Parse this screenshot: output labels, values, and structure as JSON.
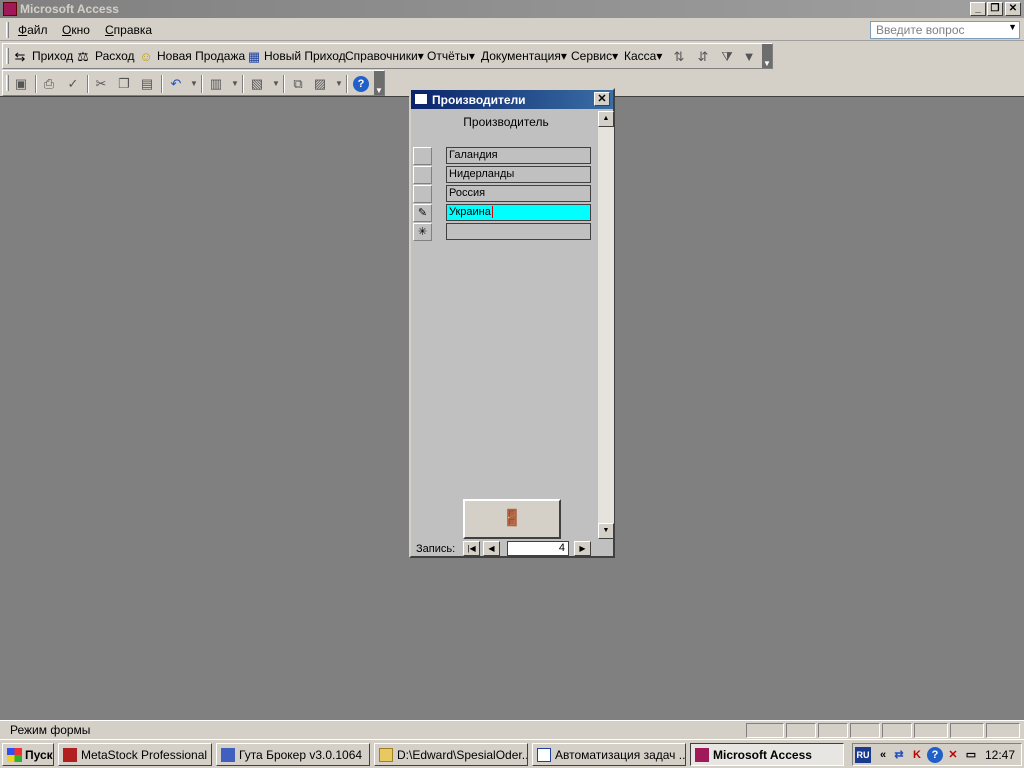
{
  "app": {
    "title": "Microsoft Access"
  },
  "menu": {
    "items": [
      {
        "label": "Файл"
      },
      {
        "label": "Окно"
      },
      {
        "label": "Справка"
      }
    ],
    "ask_placeholder": "Введите вопрос"
  },
  "toolbar_custom": {
    "items": [
      {
        "label": "Приход",
        "icon": "incoming-icon"
      },
      {
        "label": "Расход",
        "icon": "scales-icon"
      },
      {
        "label": "Новая Продажа",
        "icon": "smiley-icon"
      },
      {
        "label": "Новый Приход",
        "icon": "calculator-icon"
      },
      {
        "label": "Справочники▾"
      },
      {
        "label": "Отчёты▾"
      },
      {
        "label": "Документация▾"
      },
      {
        "label": "Сервис▾"
      },
      {
        "label": "Касса▾"
      }
    ]
  },
  "form": {
    "title": "Производители",
    "header": "Производитель",
    "records": [
      "Галандия",
      "Нидерланды",
      "Россия",
      "Украина"
    ],
    "active_index": 3,
    "new_record_marker": "✳",
    "edit_marker": "✎",
    "nav_label": "Запись:",
    "record_number": "4"
  },
  "statusbar": {
    "text": "Режим формы"
  },
  "taskbar": {
    "start_label": "Пуск",
    "tasks": [
      {
        "label": "MetaStock Professional -..."
      },
      {
        "label": "Гута Брокер v3.0.1064"
      },
      {
        "label": "D:\\Edward\\SpesialOder..."
      },
      {
        "label": "Автоматизация задач ..."
      },
      {
        "label": "Microsoft Access"
      }
    ],
    "tray": {
      "lang": "RU",
      "clock": "12:47"
    }
  }
}
